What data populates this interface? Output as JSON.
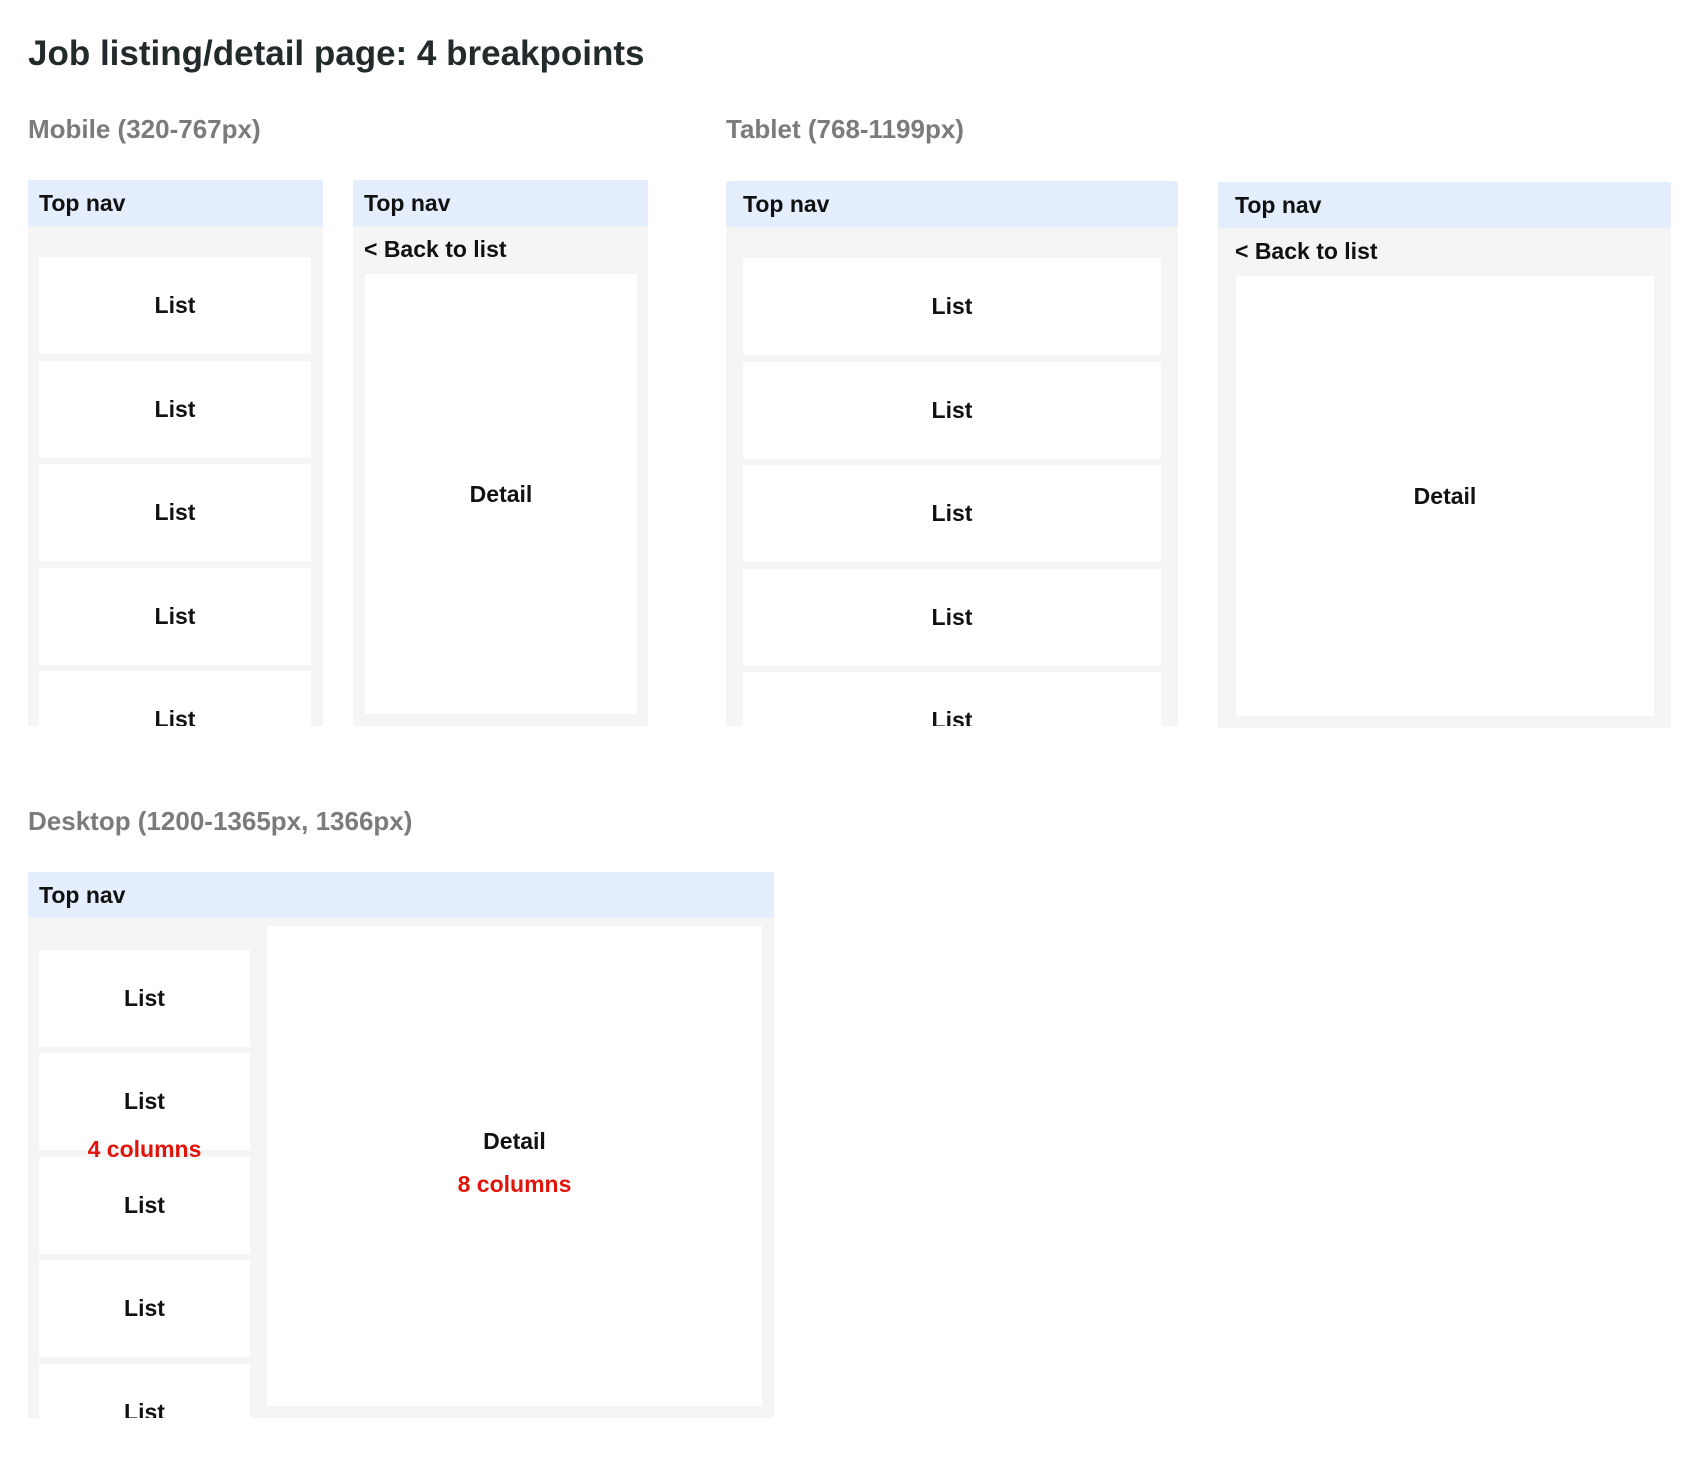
{
  "title": "Job listing/detail page: 4 breakpoints",
  "sections": {
    "mobile": "Mobile (320-767px)",
    "tablet": "Tablet (768-1199px)",
    "desktop": "Desktop (1200-1365px, 1366px)"
  },
  "labels": {
    "top_nav": "Top nav",
    "back_to_list": "< Back to list",
    "list": "List",
    "detail": "Detail"
  },
  "desktop_notes": {
    "list_columns": "4 columns",
    "detail_columns": "8 columns"
  },
  "colors": {
    "nav_bg": "#e4eefd",
    "frame_bg": "#f5f5f5",
    "note_red": "#e0140b",
    "section_gray": "#7b7b7b"
  }
}
